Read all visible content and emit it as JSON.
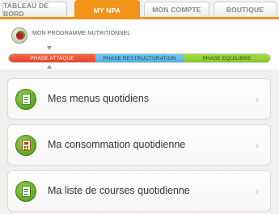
{
  "tabs": [
    {
      "label": "TABLEAU DE BORD",
      "active": false
    },
    {
      "label": "MY NPA",
      "active": true
    },
    {
      "label": "MON COMPTE",
      "active": false
    },
    {
      "label": "BOUTIQUE",
      "active": false
    }
  ],
  "program": {
    "title": "MON PROGRAMME NUTRITIONNEL",
    "icon": "plate-icon"
  },
  "phases": [
    {
      "label": "PHASE ATTAQUE",
      "color": "#e8442a",
      "current": true
    },
    {
      "label": "PHASE RESTRUCTURATION",
      "color": "#4fb1e3",
      "current": false
    },
    {
      "label": "PHASE EQUILIBRE",
      "color": "#86c52a",
      "current": false
    }
  ],
  "cards": [
    {
      "label": "Mes menus quotidiens",
      "icon": "menu-list-icon",
      "chevron": "›"
    },
    {
      "label": "Ma consommation quotidienne",
      "icon": "calculator-icon",
      "chevron": "›"
    },
    {
      "label": "Ma liste de courses quotidienne",
      "icon": "shopping-list-icon",
      "chevron": "›"
    }
  ],
  "colors": {
    "accent": "#f19418",
    "card_icon_green": "#5fa823"
  }
}
